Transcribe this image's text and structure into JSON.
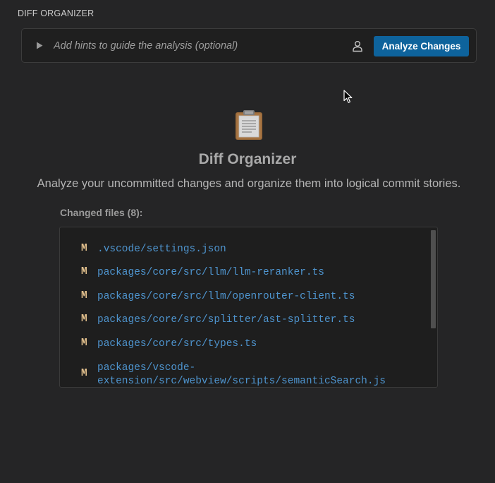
{
  "panel": {
    "title": "DIFF ORGANIZER"
  },
  "hint_bar": {
    "placeholder": "Add hints to guide the analysis (optional)",
    "value": "",
    "analyze_label": "Analyze Changes"
  },
  "main": {
    "title": "Diff Organizer",
    "subtitle": "Analyze your uncommitted changes and organize them into logical commit stories."
  },
  "changed_files": {
    "heading": "Changed files (8):",
    "items": [
      {
        "status": "M",
        "path": ".vscode/settings.json"
      },
      {
        "status": "M",
        "path": "packages/core/src/llm/llm-reranker.ts"
      },
      {
        "status": "M",
        "path": "packages/core/src/llm/openrouter-client.ts"
      },
      {
        "status": "M",
        "path": "packages/core/src/splitter/ast-splitter.ts"
      },
      {
        "status": "M",
        "path": "packages/core/src/types.ts"
      },
      {
        "status": "M",
        "path": "packages/vscode-extension/src/webview/scripts/semanticSearch.js"
      }
    ]
  },
  "icons": {
    "expand": "play-triangle-icon",
    "user": "person-icon",
    "header": "clipboard-icon",
    "pointer": "mouse-cursor-icon"
  },
  "colors": {
    "background": "#252526",
    "button": "#0e639c",
    "file_path": "#4e94ce",
    "modified_status": "#e2c08d"
  }
}
